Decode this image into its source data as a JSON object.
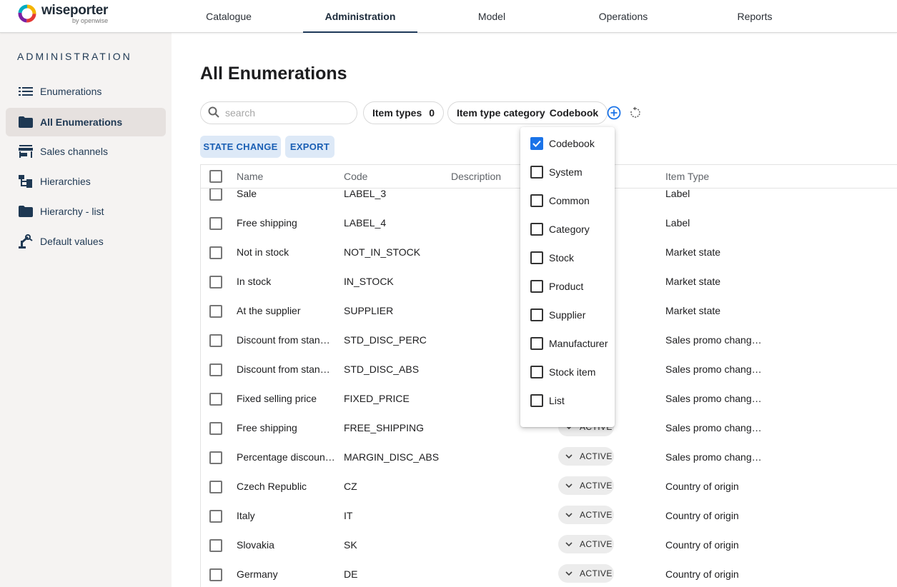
{
  "brand": {
    "name": "wiseporter",
    "sub": "by openwise"
  },
  "nav": {
    "tabs": [
      {
        "label": "Catalogue"
      },
      {
        "label": "Administration"
      },
      {
        "label": "Model"
      },
      {
        "label": "Operations"
      },
      {
        "label": "Reports"
      }
    ],
    "active": "Administration"
  },
  "sidebar": {
    "title": "ADMINISTRATION",
    "items": [
      {
        "label": "Enumerations",
        "icon": "list-icon"
      },
      {
        "label": "All Enumerations",
        "icon": "folder-icon",
        "active": true
      },
      {
        "label": "Sales channels",
        "icon": "store-icon"
      },
      {
        "label": "Hierarchies",
        "icon": "hierarchy-icon"
      },
      {
        "label": "Hierarchy - list",
        "icon": "folder-icon"
      },
      {
        "label": "Default values",
        "icon": "robot-arm-icon"
      }
    ]
  },
  "page": {
    "title": "All Enumerations"
  },
  "filters": {
    "search_placeholder": "search",
    "item_types_label": "Item types",
    "item_types_count": "0",
    "category_label": "Item type category",
    "category_value": "Codebook"
  },
  "actions": {
    "state_change": "STATE CHANGE",
    "export": "EXPORT"
  },
  "table": {
    "headers": {
      "name": "Name",
      "code": "Code",
      "description": "Description",
      "item_type": "Item Type"
    },
    "rows": [
      {
        "name": "Sale",
        "code": "LABEL_3",
        "state": "",
        "item_type": "Label"
      },
      {
        "name": "Free shipping",
        "code": "LABEL_4",
        "state": "",
        "item_type": "Label"
      },
      {
        "name": "Not in stock",
        "code": "NOT_IN_STOCK",
        "state": "",
        "item_type": "Market state"
      },
      {
        "name": "In stock",
        "code": "IN_STOCK",
        "state": "",
        "item_type": "Market state"
      },
      {
        "name": "At the supplier",
        "code": "SUPPLIER",
        "state": "",
        "item_type": "Market state"
      },
      {
        "name": "Discount from stan…",
        "code": "STD_DISC_PERC",
        "state": "",
        "item_type": "Sales promo chang…"
      },
      {
        "name": "Discount from stan…",
        "code": "STD_DISC_ABS",
        "state": "",
        "item_type": "Sales promo chang…"
      },
      {
        "name": "Fixed selling price",
        "code": "FIXED_PRICE",
        "state": "",
        "item_type": "Sales promo chang…"
      },
      {
        "name": "Free shipping",
        "code": "FREE_SHIPPING",
        "state": "ACTIVE",
        "item_type": "Sales promo chang…"
      },
      {
        "name": "Percentage discoun…",
        "code": "MARGIN_DISC_ABS",
        "state": "ACTIVE",
        "item_type": "Sales promo chang…"
      },
      {
        "name": "Czech Republic",
        "code": "CZ",
        "state": "ACTIVE",
        "item_type": "Country of origin"
      },
      {
        "name": "Italy",
        "code": "IT",
        "state": "ACTIVE",
        "item_type": "Country of origin"
      },
      {
        "name": "Slovakia",
        "code": "SK",
        "state": "ACTIVE",
        "item_type": "Country of origin"
      },
      {
        "name": "Germany",
        "code": "DE",
        "state": "ACTIVE",
        "item_type": "Country of origin"
      }
    ]
  },
  "category_dropdown": {
    "options": [
      {
        "label": "Codebook",
        "checked": true
      },
      {
        "label": "System",
        "checked": false
      },
      {
        "label": "Common",
        "checked": false
      },
      {
        "label": "Category",
        "checked": false
      },
      {
        "label": "Stock",
        "checked": false
      },
      {
        "label": "Product",
        "checked": false
      },
      {
        "label": "Supplier",
        "checked": false
      },
      {
        "label": "Manufacturer",
        "checked": false
      },
      {
        "label": "Stock item",
        "checked": false
      },
      {
        "label": "List",
        "checked": false
      }
    ]
  },
  "colors": {
    "accent": "#1a73e8",
    "sidebar_bg": "#f5f3f2",
    "action_bg": "#dde9f7",
    "action_text": "#1a5fb4"
  }
}
